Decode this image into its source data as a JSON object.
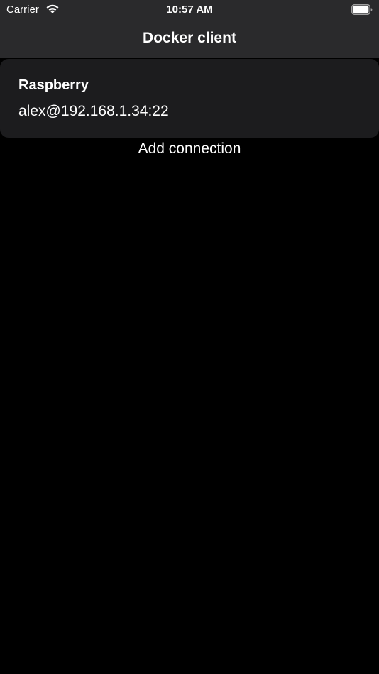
{
  "status_bar": {
    "carrier": "Carrier",
    "time": "10:57 AM",
    "icons": [
      "wifi-icon",
      "battery-icon"
    ]
  },
  "nav": {
    "title": "Docker client"
  },
  "connections": [
    {
      "name": "Raspberry",
      "address": "alex@192.168.1.34:22"
    }
  ],
  "actions": {
    "add_connection_label": "Add connection"
  },
  "colors": {
    "background": "#000000",
    "nav_background": "#2a2a2c",
    "card_background": "#1c1c1e",
    "text": "#ffffff"
  }
}
